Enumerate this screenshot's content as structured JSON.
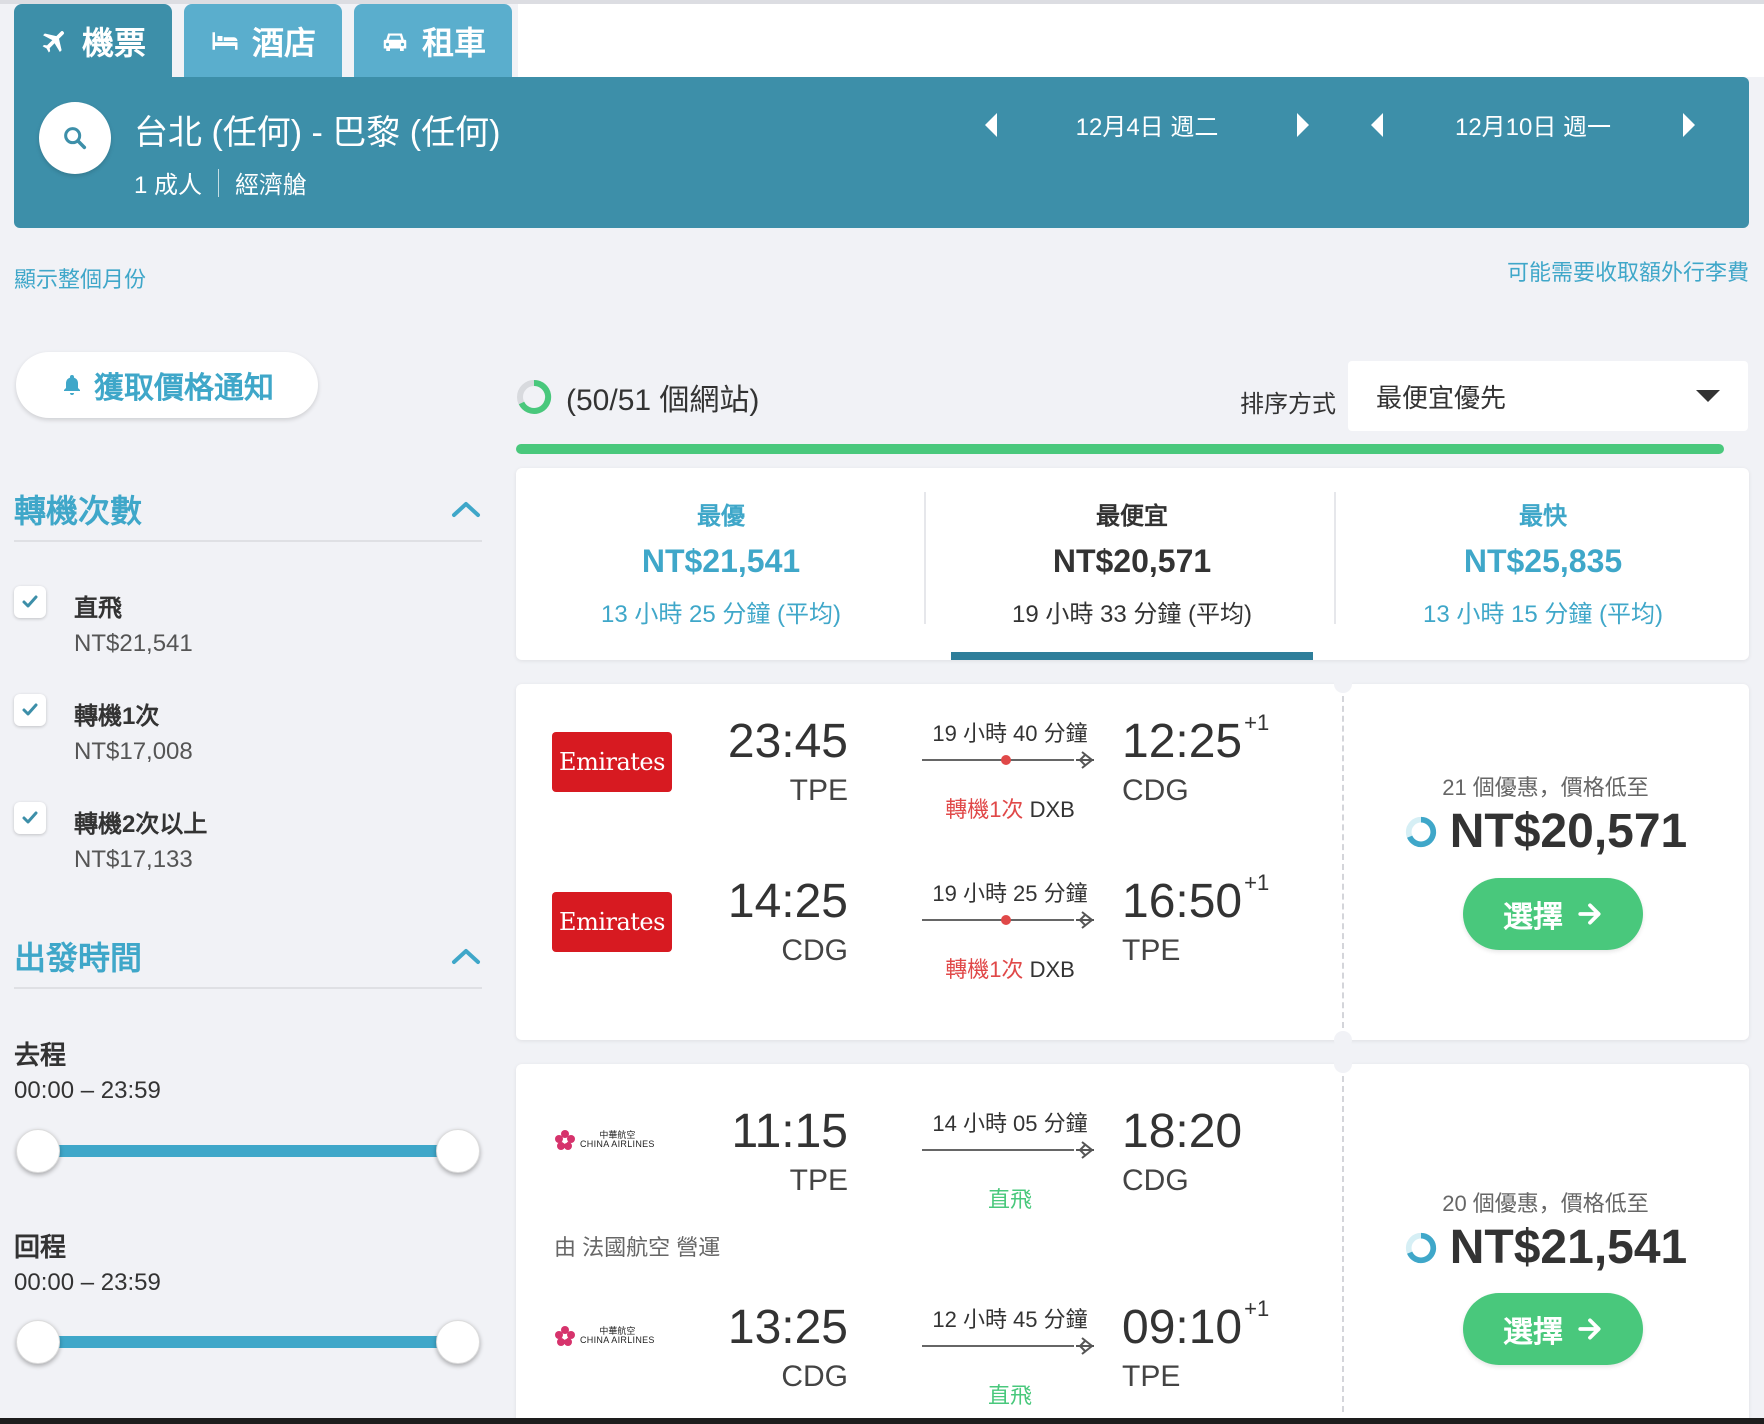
{
  "tabs": [
    {
      "label": "機票",
      "icon": "plane-icon",
      "active": true
    },
    {
      "label": "酒店",
      "icon": "bed-icon",
      "active": false
    },
    {
      "label": "租車",
      "icon": "car-icon",
      "active": false
    }
  ],
  "search": {
    "route": "台北 (任何) - 巴黎 (任何)",
    "passengers": "1 成人",
    "cabin": "經濟艙",
    "depart_date": "12月4日 週二",
    "return_date": "12月10日 週一"
  },
  "links": {
    "month": "顯示整個月份",
    "baggage": "可能需要收取額外行李費"
  },
  "sidebar": {
    "alert_label": "獲取價格通知",
    "stops_title": "轉機次數",
    "stops": [
      {
        "label": "直飛",
        "price": "NT$21,541",
        "checked": true
      },
      {
        "label": "轉機1次",
        "price": "NT$17,008",
        "checked": true
      },
      {
        "label": "轉機2次以上",
        "price": "NT$17,133",
        "checked": true
      }
    ],
    "time_title": "出發時間",
    "outbound_label": "去程",
    "outbound_range": "00:00 – 23:59",
    "return_label": "回程",
    "return_range": "00:00 – 23:59"
  },
  "results": {
    "progress_text": "(50/51 個網站)",
    "sort_label": "排序方式",
    "sort_value": "最便宜優先"
  },
  "summary": [
    {
      "title": "最優",
      "price": "NT$21,541",
      "duration": "13 小時 25 分鐘 (平均)"
    },
    {
      "title": "最便宜",
      "price": "NT$20,571",
      "duration": "19 小時 33 分鐘 (平均)"
    },
    {
      "title": "最快",
      "price": "NT$25,835",
      "duration": "13 小時 15 分鐘 (平均)"
    }
  ],
  "cards": [
    {
      "legs": [
        {
          "airline": "Emirates",
          "dep_time": "23:45",
          "dep_code": "TPE",
          "duration": "19 小時 40 分鐘",
          "stops_label": "轉機1次",
          "via": "DXB",
          "arr_time": "12:25",
          "arr_plus": "+1",
          "arr_code": "CDG"
        },
        {
          "airline": "Emirates",
          "dep_time": "14:25",
          "dep_code": "CDG",
          "duration": "19 小時 25 分鐘",
          "stops_label": "轉機1次",
          "via": "DXB",
          "arr_time": "16:50",
          "arr_plus": "+1",
          "arr_code": "TPE"
        }
      ],
      "deal_text": "21 個優惠，價格低至",
      "price": "NT$20,571",
      "button": "選擇"
    },
    {
      "legs": [
        {
          "airline": "CHINA AIRLINES",
          "airline_zh": "中華航空",
          "dep_time": "11:15",
          "dep_code": "TPE",
          "duration": "14 小時 05 分鐘",
          "stops_label": "直飛",
          "arr_time": "18:20",
          "arr_code": "CDG"
        },
        {
          "airline": "CHINA AIRLINES",
          "airline_zh": "中華航空",
          "dep_time": "13:25",
          "dep_code": "CDG",
          "duration": "12 小時 45 分鐘",
          "stops_label": "直飛",
          "arr_time": "09:10",
          "arr_plus": "+1",
          "arr_code": "TPE"
        }
      ],
      "operated_by": "由 法國航空 營運",
      "deal_text": "20 個優惠，價格低至",
      "price": "NT$21,541",
      "button": "選擇"
    }
  ],
  "colors": {
    "primary": "#3d8fa9",
    "tab_inactive": "#5aaecd",
    "link_blue": "#3fa7c9",
    "green": "#49c87c",
    "stop_red": "#e04848",
    "emirates_red": "#d71a21"
  }
}
